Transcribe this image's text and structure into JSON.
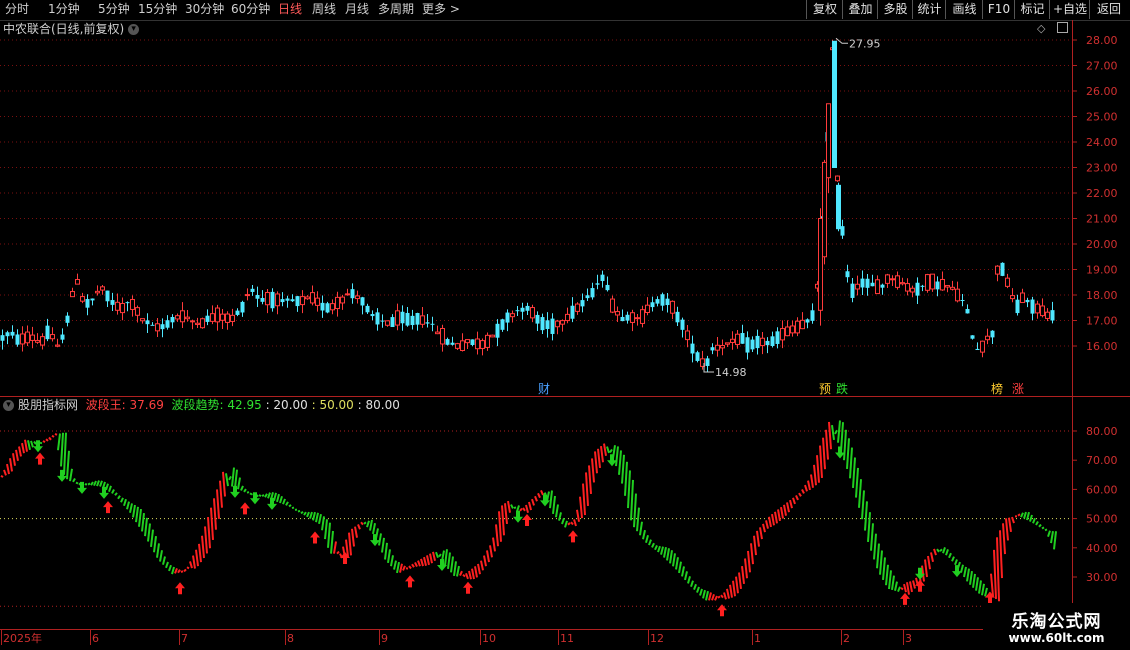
{
  "toolbar": {
    "periods": [
      "分时",
      "1分钟",
      "5分钟",
      "15分钟",
      "30分钟",
      "60分钟",
      "日线",
      "周线",
      "月线",
      "多周期",
      "更多 >"
    ],
    "active_period": "日线",
    "right_buttons": [
      "复权",
      "叠加",
      "多股",
      "统计",
      "画线",
      "F10",
      "标记",
      "+自选",
      "返回"
    ]
  },
  "main_chart": {
    "title": "中农联合(日线,前复权)",
    "price_axis": [
      "28.00",
      "27.00",
      "26.00",
      "25.00",
      "24.00",
      "23.00",
      "22.00",
      "21.00",
      "20.00",
      "19.00",
      "18.00",
      "17.00",
      "16.00"
    ],
    "high_label": "27.95",
    "low_label": "14.98",
    "markers": [
      "财",
      "预",
      "跌",
      "榜",
      "涨"
    ]
  },
  "indicator": {
    "name": "股朋指标网",
    "line1_label": "波段王: 37.69",
    "line2_label": "波段趋势: 42.95",
    "levels": [
      ": 20.00",
      ": 50.00",
      ": 80.00"
    ],
    "axis": [
      "80.00",
      "70.00",
      "60.00",
      "50.00",
      "40.00",
      "30.00"
    ],
    "colors": {
      "up": "#ff2020",
      "down": "#20d020",
      "yellow": "#e0e060"
    }
  },
  "date_axis": [
    "2025年",
    "6",
    "7",
    "8",
    "9",
    "10",
    "11",
    "12",
    "1",
    "2",
    "3"
  ],
  "watermark": {
    "line1": "乐淘公式网",
    "line2": "www.60lt.com"
  },
  "chart_data": [
    {
      "type": "candlestick",
      "title": "中农联合(日线,前复权)",
      "ylim": [
        15.0,
        28.3
      ],
      "anchor_points": [
        [
          0,
          16.3
        ],
        [
          10,
          16.5
        ],
        [
          20,
          16.2
        ],
        [
          30,
          16.4
        ],
        [
          40,
          16.1
        ],
        [
          48,
          16.6
        ],
        [
          58,
          15.9
        ],
        [
          66,
          16.9
        ],
        [
          76,
          18.7
        ],
        [
          84,
          17.6
        ],
        [
          92,
          17.8
        ],
        [
          100,
          18.3
        ],
        [
          110,
          17.8
        ],
        [
          120,
          17.4
        ],
        [
          130,
          17.8
        ],
        [
          140,
          17.1
        ],
        [
          150,
          16.8
        ],
        [
          160,
          16.7
        ],
        [
          170,
          17.0
        ],
        [
          180,
          17.2
        ],
        [
          190,
          17.0
        ],
        [
          200,
          16.9
        ],
        [
          210,
          17.1
        ],
        [
          220,
          17.2
        ],
        [
          230,
          17.0
        ],
        [
          240,
          17.4
        ],
        [
          250,
          18.3
        ],
        [
          260,
          17.8
        ],
        [
          270,
          17.9
        ],
        [
          280,
          17.7
        ],
        [
          290,
          17.8
        ],
        [
          300,
          17.7
        ],
        [
          310,
          17.9
        ],
        [
          320,
          17.6
        ],
        [
          330,
          17.5
        ],
        [
          340,
          17.8
        ],
        [
          350,
          18.1
        ],
        [
          360,
          17.9
        ],
        [
          370,
          17.2
        ],
        [
          380,
          17.0
        ],
        [
          390,
          16.9
        ],
        [
          400,
          17.1
        ],
        [
          410,
          17.0
        ],
        [
          420,
          17.1
        ],
        [
          430,
          16.9
        ],
        [
          440,
          16.4
        ],
        [
          450,
          16.1
        ],
        [
          460,
          16.0
        ],
        [
          470,
          16.2
        ],
        [
          480,
          16.0
        ],
        [
          490,
          16.3
        ],
        [
          500,
          16.8
        ],
        [
          510,
          17.2
        ],
        [
          520,
          17.5
        ],
        [
          530,
          17.4
        ],
        [
          540,
          16.9
        ],
        [
          550,
          16.8
        ],
        [
          560,
          16.9
        ],
        [
          570,
          17.3
        ],
        [
          580,
          17.6
        ],
        [
          590,
          18.0
        ],
        [
          600,
          18.7
        ],
        [
          606,
          18.5
        ],
        [
          612,
          17.6
        ],
        [
          620,
          17.1
        ],
        [
          630,
          17.2
        ],
        [
          640,
          17.0
        ],
        [
          650,
          17.6
        ],
        [
          660,
          17.9
        ],
        [
          670,
          17.6
        ],
        [
          680,
          17.0
        ],
        [
          690,
          16.1
        ],
        [
          700,
          15.4
        ],
        [
          706,
          15.3
        ],
        [
          712,
          15.9
        ],
        [
          720,
          16.0
        ],
        [
          730,
          16.1
        ],
        [
          740,
          16.3
        ],
        [
          750,
          16.0
        ],
        [
          760,
          16.2
        ],
        [
          770,
          16.1
        ],
        [
          780,
          16.4
        ],
        [
          790,
          16.6
        ],
        [
          800,
          16.8
        ],
        [
          810,
          17.0
        ],
        [
          815,
          17.4
        ],
        [
          820,
          19.8
        ],
        [
          824,
          22.0
        ],
        [
          828,
          24.9
        ],
        [
          832,
          27.6
        ],
        [
          836,
          23.0
        ],
        [
          840,
          21.5
        ],
        [
          845,
          19.1
        ],
        [
          852,
          18.2
        ],
        [
          860,
          18.5
        ],
        [
          870,
          18.4
        ],
        [
          880,
          18.3
        ],
        [
          890,
          18.7
        ],
        [
          900,
          18.5
        ],
        [
          910,
          18.2
        ],
        [
          920,
          18.3
        ],
        [
          930,
          18.5
        ],
        [
          940,
          18.4
        ],
        [
          950,
          18.3
        ],
        [
          960,
          17.9
        ],
        [
          966,
          17.5
        ],
        [
          972,
          16.4
        ],
        [
          978,
          15.8
        ],
        [
          985,
          16.2
        ],
        [
          992,
          16.5
        ],
        [
          998,
          19.5
        ],
        [
          1004,
          18.8
        ],
        [
          1010,
          18.1
        ],
        [
          1016,
          17.5
        ],
        [
          1022,
          17.9
        ],
        [
          1030,
          17.6
        ],
        [
          1040,
          17.4
        ],
        [
          1050,
          17.2
        ],
        [
          1056,
          17.1
        ]
      ]
    },
    {
      "type": "area",
      "title": "股朋指标网",
      "series": [
        {
          "name": "波段王",
          "last": 37.69
        },
        {
          "name": "波段趋势",
          "last": 42.95
        }
      ],
      "levels": [
        20,
        50,
        80
      ],
      "ylim": [
        22,
        87
      ],
      "anchor_points": [
        [
          0,
          64
        ],
        [
          12,
          72
        ],
        [
          25,
          77
        ],
        [
          40,
          76
        ],
        [
          55,
          79
        ],
        [
          62,
          66
        ],
        [
          68,
          63
        ],
        [
          80,
          62
        ],
        [
          100,
          61
        ],
        [
          115,
          58
        ],
        [
          130,
          52
        ],
        [
          145,
          44
        ],
        [
          158,
          36
        ],
        [
          172,
          31
        ],
        [
          185,
          32
        ],
        [
          200,
          42
        ],
        [
          215,
          58
        ],
        [
          224,
          67
        ],
        [
          232,
          61
        ],
        [
          245,
          59
        ],
        [
          260,
          58
        ],
        [
          275,
          56
        ],
        [
          290,
          54
        ],
        [
          305,
          51
        ],
        [
          320,
          48
        ],
        [
          330,
          38
        ],
        [
          340,
          38
        ],
        [
          350,
          46
        ],
        [
          362,
          49
        ],
        [
          375,
          44
        ],
        [
          385,
          36
        ],
        [
          398,
          31
        ],
        [
          410,
          34
        ],
        [
          425,
          37
        ],
        [
          435,
          39
        ],
        [
          445,
          34
        ],
        [
          455,
          30
        ],
        [
          465,
          31
        ],
        [
          480,
          35
        ],
        [
          492,
          42
        ],
        [
          500,
          54
        ],
        [
          508,
          56
        ],
        [
          518,
          52
        ],
        [
          530,
          56
        ],
        [
          542,
          60
        ],
        [
          552,
          52
        ],
        [
          565,
          47
        ],
        [
          575,
          50
        ],
        [
          585,
          65
        ],
        [
          595,
          73
        ],
        [
          605,
          76
        ],
        [
          614,
          70
        ],
        [
          622,
          62
        ],
        [
          632,
          48
        ],
        [
          645,
          42
        ],
        [
          660,
          38
        ],
        [
          675,
          33
        ],
        [
          690,
          27
        ],
        [
          705,
          22
        ],
        [
          715,
          22
        ],
        [
          725,
          25
        ],
        [
          740,
          32
        ],
        [
          755,
          45
        ],
        [
          770,
          51
        ],
        [
          785,
          55
        ],
        [
          800,
          59
        ],
        [
          810,
          64
        ],
        [
          820,
          75
        ],
        [
          830,
          84
        ],
        [
          838,
          76
        ],
        [
          848,
          66
        ],
        [
          858,
          55
        ],
        [
          868,
          42
        ],
        [
          878,
          32
        ],
        [
          888,
          26
        ],
        [
          898,
          25
        ],
        [
          905,
          28
        ],
        [
          915,
          29
        ],
        [
          925,
          36
        ],
        [
          935,
          40
        ],
        [
          948,
          37
        ],
        [
          958,
          33
        ],
        [
          968,
          28
        ],
        [
          980,
          24
        ],
        [
          988,
          23
        ],
        [
          995,
          42
        ],
        [
          1005,
          50
        ],
        [
          1018,
          51
        ],
        [
          1030,
          49
        ],
        [
          1045,
          46
        ],
        [
          1056,
          38
        ]
      ]
    }
  ]
}
